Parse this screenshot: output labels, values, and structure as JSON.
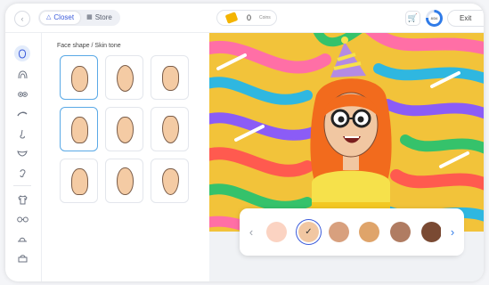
{
  "topbar": {
    "collapse_icon": "chevron-left-icon",
    "tabs": [
      {
        "label": "Closet",
        "icon": "hanger-icon",
        "active": true
      },
      {
        "label": "Store",
        "icon": "store-icon",
        "active": false
      }
    ],
    "coins": {
      "count": "0",
      "unit": "Coins",
      "icon": "coin-icon",
      "color": "#f4b400"
    },
    "cart_icon": "cart-icon",
    "progress": {
      "label": "8/34",
      "fraction": 0.76
    },
    "exit_label": "Exit"
  },
  "sidebar": {
    "items": [
      {
        "name": "face-shape",
        "icon": "face-icon",
        "active": true
      },
      {
        "name": "hair",
        "icon": "hair-icon"
      },
      {
        "name": "eyes",
        "icon": "eye-icon"
      },
      {
        "name": "eyebrows",
        "icon": "eyebrow-icon"
      },
      {
        "name": "nose",
        "icon": "nose-icon"
      },
      {
        "name": "mouth",
        "icon": "mouth-icon"
      },
      {
        "name": "ears",
        "icon": "ear-icon"
      },
      {
        "name": "clothing",
        "icon": "shirt-icon"
      },
      {
        "name": "glasses",
        "icon": "glasses-icon"
      },
      {
        "name": "hats",
        "icon": "hat-icon"
      },
      {
        "name": "accessories",
        "icon": "bag-icon"
      }
    ]
  },
  "main": {
    "section_title": "Face shape / Skin tone",
    "face_shapes": [
      {
        "shape": "round",
        "selected": true
      },
      {
        "shape": "oval"
      },
      {
        "shape": "soft-square"
      },
      {
        "shape": "oblong",
        "selected": true
      },
      {
        "shape": "heart"
      },
      {
        "shape": "diamond"
      },
      {
        "shape": "pear"
      },
      {
        "shape": "long"
      },
      {
        "shape": "egg"
      }
    ]
  },
  "skin_tones": {
    "prev_icon": "chevron-left-icon",
    "next_icon": "chevron-right-icon",
    "selected_check_icon": "check-icon",
    "colors": [
      "#fbd3c2",
      "#f1c7a2",
      "#d8a07e",
      "#dfa46a",
      "#b07c62",
      "#7a4a33"
    ],
    "selected_index": 1,
    "accent": "#3b5bdb"
  }
}
